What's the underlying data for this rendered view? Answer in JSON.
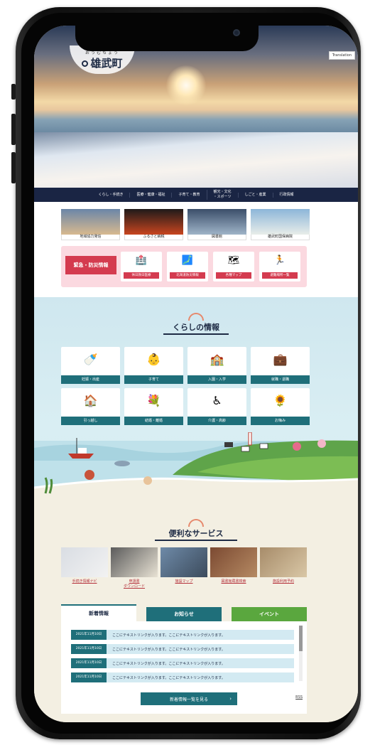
{
  "site": {
    "logo_ruby": "おうむちょう",
    "logo_text": "雄武町",
    "translate_label": "Translation"
  },
  "nav": {
    "items": [
      "くらし・手続き",
      "医療・健康・福祉",
      "子育て・教育",
      "観光・文化\n・スポーツ",
      "しごと・産業",
      "行政情報"
    ]
  },
  "featured": [
    {
      "label": "地域協力発信",
      "colors": [
        "#6b86a8",
        "#d8b98f"
      ]
    },
    {
      "label": "ふるさと納税",
      "colors": [
        "#1e1a1a",
        "#c8451f"
      ]
    },
    {
      "label": "図書館",
      "colors": [
        "#3b4e6a",
        "#9fb4c8"
      ]
    },
    {
      "label": "雄武町国保病院",
      "colors": [
        "#8db6d9",
        "#e8ede9"
      ]
    }
  ],
  "emergency": {
    "title": "緊急・防災情報",
    "items": [
      {
        "label": "休日救日医療",
        "icon": "🏥"
      },
      {
        "label": "北海道防災情報",
        "icon": "🗾"
      },
      {
        "label": "各種マップ",
        "icon": "🗺"
      },
      {
        "label": "避難場所一覧",
        "icon": "🏃"
      }
    ]
  },
  "life": {
    "title": "くらしの情報",
    "items": [
      {
        "label": "妊娠・出産",
        "icon": "🍼"
      },
      {
        "label": "子育て",
        "icon": "👶"
      },
      {
        "label": "入園・入学",
        "icon": "🏫"
      },
      {
        "label": "就職・退職",
        "icon": "💼"
      },
      {
        "label": "引っ越し",
        "icon": "🏠"
      },
      {
        "label": "結婚・離婚",
        "icon": "💐"
      },
      {
        "label": "介護・高齢",
        "icon": "♿"
      },
      {
        "label": "お悔み",
        "icon": "🌻"
      }
    ]
  },
  "services": {
    "title": "便利なサービス",
    "items": [
      {
        "label": "手続き情報ナビ",
        "colors": [
          "#d9dde3",
          "#f2f2f2"
        ]
      },
      {
        "label": "申請書\nダウンロード",
        "colors": [
          "#5b5b5b",
          "#e8e2d4"
        ]
      },
      {
        "label": "施設マップ",
        "colors": [
          "#6e8aa8",
          "#3c4b5c"
        ]
      },
      {
        "label": "図書館蔵書検索",
        "colors": [
          "#7c4a32",
          "#b58a63"
        ]
      },
      {
        "label": "施設利用予約",
        "colors": [
          "#a78c6a",
          "#d9c7a6"
        ]
      }
    ]
  },
  "tabs": {
    "items": [
      "新着情報",
      "お知らせ",
      "イベント"
    ],
    "colors": [
      "#ffffff",
      "#1f6f7a",
      "#5aa73e"
    ]
  },
  "news": {
    "rows": [
      {
        "date": "2021年11月10日",
        "text": "ここにテキストリンクが入ります。ここにテキストリンクが入ります。"
      },
      {
        "date": "2021年11月10日",
        "text": "ここにテキストリンクが入ります。ここにテキストリンクが入ります。"
      },
      {
        "date": "2021年11月10日",
        "text": "ここにテキストリンクが入ります。ここにテキストリンクが入ります。"
      },
      {
        "date": "2021年11月10日",
        "text": "ここにテキストリンクが入ります。ここにテキストリンクが入ります。"
      }
    ],
    "more_label": "新着情報一覧を見る",
    "rss_label": "RSS"
  }
}
